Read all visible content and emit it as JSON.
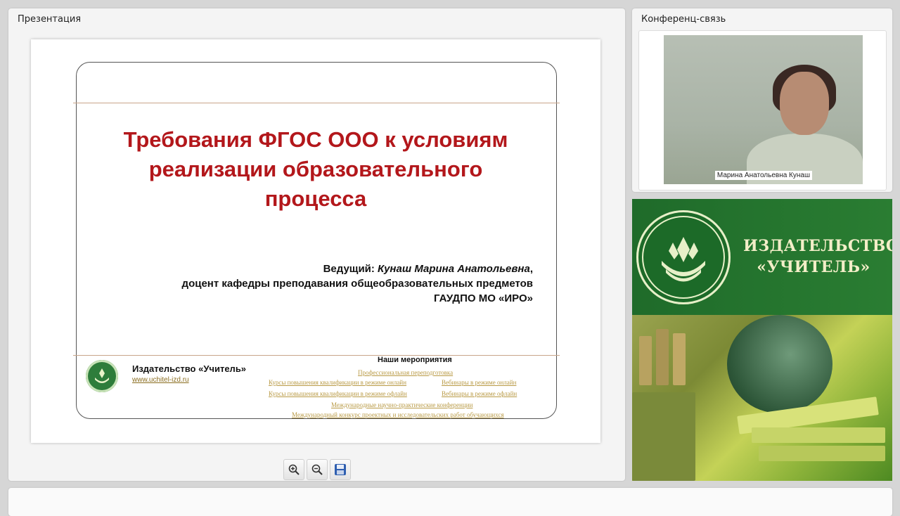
{
  "presentation": {
    "title": "Презентация",
    "slide": {
      "title_lines": [
        "Требования ФГОС ООО к условиям",
        "реализации образовательного",
        "процесса"
      ],
      "presenter_prefix": "Ведущий: ",
      "presenter_name": "Кунаш Марина Анатольевна",
      "presenter_comma": ",",
      "position": "доцент кафедры преподавания общеобразовательных предметов",
      "organization": "ГАУДПО МО «ИРО»",
      "publisher_name": "Издательство «Учитель»",
      "publisher_url": "www.uchitel-izd.ru",
      "events_title": "Наши мероприятия",
      "events": [
        "Профессиональная переподготовка",
        "Курсы повышения квалификации в режиме онлайн",
        "Вебинары в режиме онлайн",
        "Курсы повышения квалификации в режиме офлайн",
        "Вебинары в режиме офлайн",
        "Международные научно-практические конференции",
        "Международный конкурс проектных и исследовательских работ обучающихся"
      ]
    },
    "toolbar": [
      "zoom-in-icon",
      "zoom-out-icon",
      "save-icon"
    ]
  },
  "conference": {
    "title": "Конференц-связь",
    "participant_name": "Марина Анатольевна Кунаш"
  },
  "ad": {
    "line1": "ИЗДАТЕЛЬСТВО",
    "line2": "«УЧИТЕЛЬ»",
    "brand_green": "#1f6b2a",
    "text_color": "#f3eec8"
  },
  "colors": {
    "title_red": "#b3171b",
    "link_gold": "#b99a45"
  }
}
